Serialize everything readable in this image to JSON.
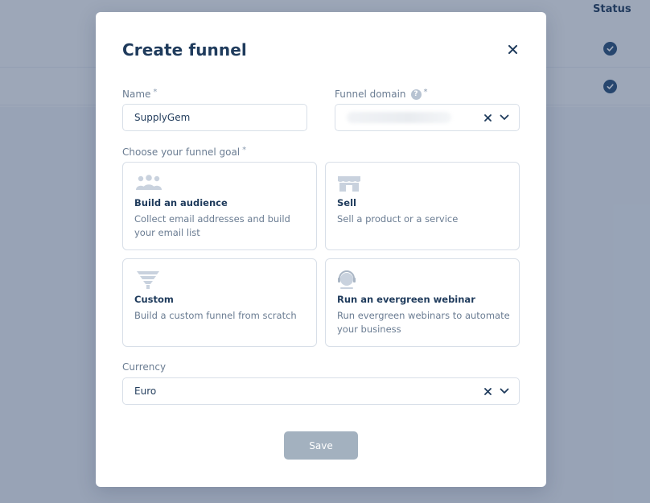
{
  "background": {
    "status_header": "Status",
    "rows": [
      {
        "status_icon": "check-circle-icon"
      },
      {
        "status_icon": "check-circle-icon"
      }
    ]
  },
  "modal": {
    "title": "Create funnel",
    "close_icon": "close-icon",
    "name": {
      "label": "Name",
      "required_mark": "*",
      "value": "SupplyGem"
    },
    "funnel_domain": {
      "label": "Funnel domain",
      "required_mark": "*",
      "help_icon": "question-icon",
      "help_glyph": "?",
      "clear_icon": "clear-icon",
      "dropdown_icon": "chevron-down-icon"
    },
    "goal": {
      "label": "Choose your funnel goal",
      "required_mark": "*",
      "options": [
        {
          "icon": "audience-icon",
          "title": "Build an audience",
          "description": "Collect email addresses and build your email list"
        },
        {
          "icon": "store-icon",
          "title": "Sell",
          "description": "Sell a product or a service"
        },
        {
          "icon": "funnel-icon",
          "title": "Custom",
          "description": "Build a custom funnel from scratch"
        },
        {
          "icon": "webinar-icon",
          "title": "Run an evergreen webinar",
          "description": "Run evergreen webinars to automate your business"
        }
      ]
    },
    "currency": {
      "label": "Currency",
      "value": "Euro",
      "clear_icon": "clear-icon",
      "dropdown_icon": "chevron-down-icon"
    },
    "save_label": "Save"
  },
  "colors": {
    "primary_text": "#1f3b5c",
    "muted_text": "#6a7c92",
    "border": "#d8dfe8",
    "save_disabled": "#a3b1bf",
    "status_check": "#2a5079"
  }
}
